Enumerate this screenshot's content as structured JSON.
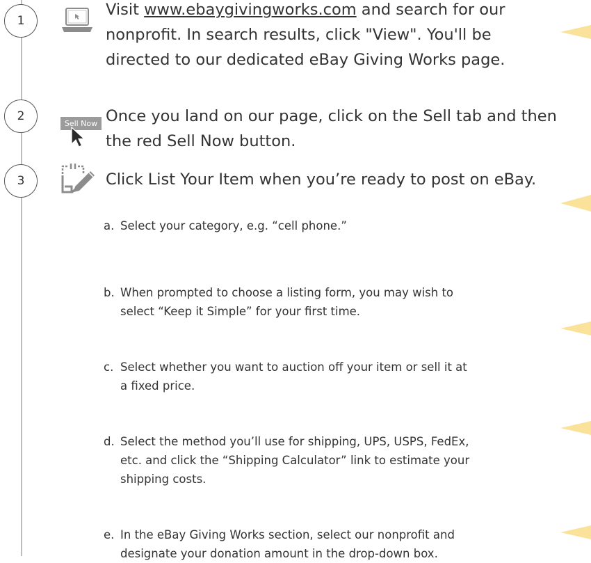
{
  "steps": [
    {
      "number": "1",
      "text_before_link": "Visit ",
      "link": "www.ebaygivingworks.com",
      "text_after_link": "  and search for our",
      "line2": "nonprofit. In search results, click \"View\". You'll be",
      "line3": "directed to our dedicated eBay Giving Works page.",
      "icon": "laptop-icon"
    },
    {
      "number": "2",
      "badge": "Sell Now",
      "line1": "Once you land on our page, click on the Sell tab and then",
      "line2": "the red Sell Now button.",
      "icon": "cursor-icon"
    },
    {
      "number": "3",
      "line1": "Click List Your Item when you’re ready to post on eBay.",
      "icon": "clipboard-pencil-icon"
    }
  ],
  "substeps": [
    {
      "letter": "a.",
      "lines": [
        "Select your category, e.g. “cell phone.”"
      ]
    },
    {
      "letter": "b.",
      "lines": [
        "When prompted to choose a listing form, you may wish to",
        "select “Keep it Simple” for your first time."
      ]
    },
    {
      "letter": "c.",
      "lines": [
        "Select whether you want to auction off your item or sell it at",
        "a fixed price."
      ]
    },
    {
      "letter": "d.",
      "lines": [
        "Select the method you’ll use for shipping, UPS, USPS, FedEx,",
        "etc. and click the “Shipping Calculator” link to estimate your",
        "shipping costs."
      ]
    },
    {
      "letter": "e.",
      "lines": [
        "In the eBay Giving Works section, select our nonprofit and",
        "designate your donation amount in the drop-down box."
      ]
    }
  ],
  "colors": {
    "accent_yellow": "#fbe29a",
    "circle_border": "#555555",
    "timeline": "#bdbdbd",
    "badge_bg": "#9b9b9b"
  }
}
